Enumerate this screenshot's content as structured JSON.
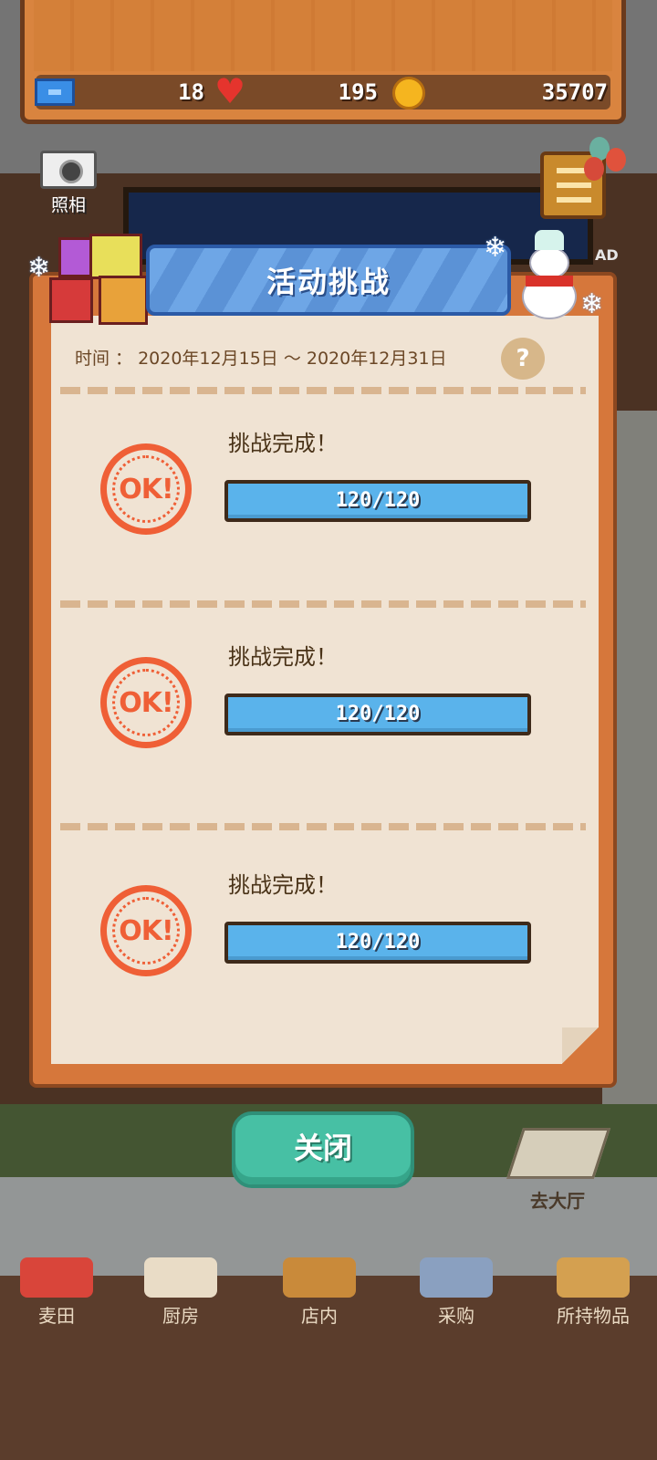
{
  "currency": {
    "tickets": "18",
    "hearts": "195",
    "coins": "35707"
  },
  "camera_label": "照相",
  "ad_label": "AD",
  "modal": {
    "title": "活动挑战",
    "time_text": "时间 ： 2020年12月15日 ～ 2020年12月31日",
    "help_symbol": "?",
    "challenges": [
      {
        "badge": "OK!",
        "label": "挑战完成！",
        "progress": "120/120",
        "fraction": 1.0
      },
      {
        "badge": "OK!",
        "label": "挑战完成！",
        "progress": "120/120",
        "fraction": 1.0
      },
      {
        "badge": "OK!",
        "label": "挑战完成！",
        "progress": "120/120",
        "fraction": 1.0
      }
    ],
    "close_label": "关闭"
  },
  "hall_label": "去大厅",
  "nav": {
    "items": [
      {
        "label": "麦田",
        "icon": "wheat-field-icon"
      },
      {
        "label": "厨房",
        "icon": "kitchen-icon"
      },
      {
        "label": "店内",
        "icon": "shop-icon"
      },
      {
        "label": "采购",
        "icon": "purchase-icon"
      },
      {
        "label": "所持物品",
        "icon": "inventory-icon"
      }
    ]
  },
  "colors": {
    "progress_fill": "#5ab3eb",
    "ok_badge": "#ef5f36",
    "close_button": "#47c0a4",
    "title_ribbon": "#6ea6e6"
  }
}
